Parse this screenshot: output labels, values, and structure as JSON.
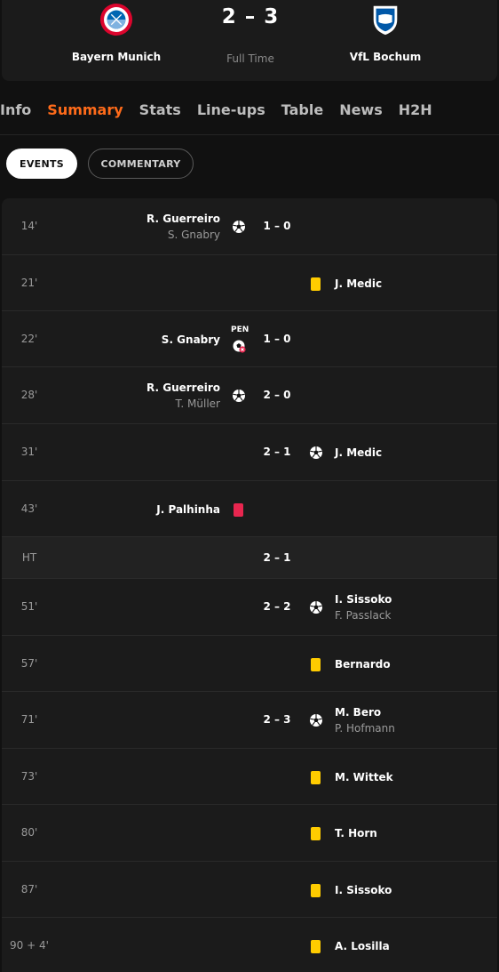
{
  "match": {
    "home_team": "Bayern Munich",
    "away_team": "VfL Bochum",
    "score": "2 – 3",
    "status": "Full Time",
    "home_crest_text": "FC BAYERN MÜNCHEN",
    "away_crest_text": "Bochum 1848"
  },
  "tabs": [
    "Info",
    "Summary",
    "Stats",
    "Line-ups",
    "Table",
    "News",
    "H2H"
  ],
  "active_tab": "Summary",
  "toggles": {
    "events": "EVENTS",
    "commentary": "COMMENTARY"
  },
  "colors": {
    "accent": "#ff6b1a",
    "yellow_card": "#ffcc00",
    "red_card": "#e8264f"
  },
  "events": [
    {
      "minute": "14'",
      "side": "home",
      "type": "goal",
      "player": "R. Guerreiro",
      "secondary": "S. Gnabry",
      "score": "1 – 0"
    },
    {
      "minute": "21'",
      "side": "away",
      "type": "yellow-card",
      "player": "J. Medic"
    },
    {
      "minute": "22'",
      "side": "home",
      "type": "penalty-missed",
      "player": "S. Gnabry",
      "score": "1 – 0",
      "label": "PEN"
    },
    {
      "minute": "28'",
      "side": "home",
      "type": "goal",
      "player": "R. Guerreiro",
      "secondary": "T. Müller",
      "score": "2 – 0"
    },
    {
      "minute": "31'",
      "side": "away",
      "type": "goal",
      "player": "J. Medic",
      "score": "2 – 1"
    },
    {
      "minute": "43'",
      "side": "home",
      "type": "red-card",
      "player": "J. Palhinha"
    },
    {
      "minute": "HT",
      "type": "half-time",
      "score": "2 – 1"
    },
    {
      "minute": "51'",
      "side": "away",
      "type": "goal",
      "player": "I. Sissoko",
      "secondary": "F. Passlack",
      "score": "2 – 2"
    },
    {
      "minute": "57'",
      "side": "away",
      "type": "yellow-card",
      "player": "Bernardo"
    },
    {
      "minute": "71'",
      "side": "away",
      "type": "goal",
      "player": "M. Bero",
      "secondary": "P. Hofmann",
      "score": "2 – 3"
    },
    {
      "minute": "73'",
      "side": "away",
      "type": "yellow-card",
      "player": "M. Wittek"
    },
    {
      "minute": "80'",
      "side": "away",
      "type": "yellow-card",
      "player": "T. Horn"
    },
    {
      "minute": "87'",
      "side": "away",
      "type": "yellow-card",
      "player": "I. Sissoko"
    },
    {
      "minute": "90 + 4'",
      "side": "away",
      "type": "yellow-card",
      "player": "A. Losilla"
    }
  ]
}
